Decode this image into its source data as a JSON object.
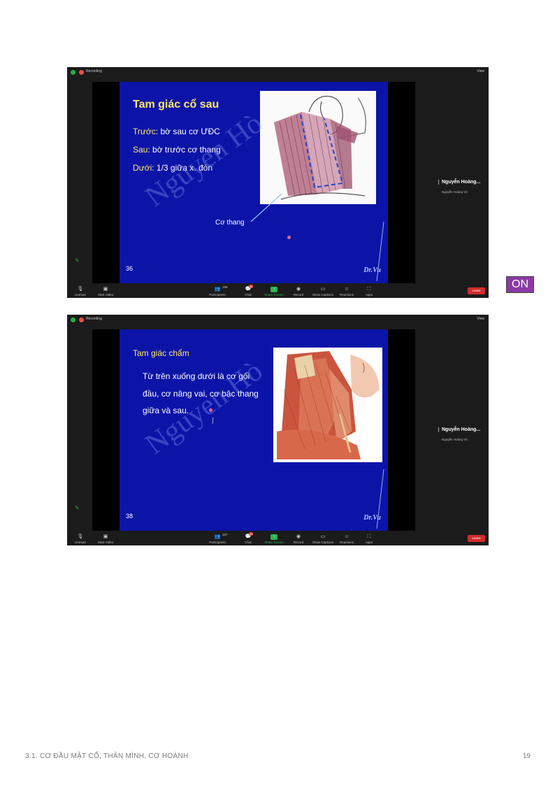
{
  "zoom_common": {
    "recording_label": "Recording",
    "view_label": "View",
    "participant_name": "Nguyễn Hoàng...",
    "participant_sub": "Nguyễn Hoàng Vũ",
    "toolbar": {
      "unmute": "Unmute",
      "start_video": "Start Video",
      "participants": "Participants",
      "chat": "Chat",
      "share_screen": "Share Screen",
      "record": "Record",
      "show_captions": "Show Captions",
      "reactions": "Reactions",
      "apps": "Apps",
      "leave": "Leave"
    }
  },
  "slide1": {
    "title": "Tam giác cổ sau",
    "line1_label": "Trước",
    "line1_text": ": bờ sau cơ ƯĐC",
    "line2_label": "Sau",
    "line2_text": ": bờ trước cơ thang",
    "line3_label": "Dưới",
    "line3_text": ": 1/3 giữa x. đòn",
    "annotation": "Cơ thang",
    "watermark": "Nguyen Hò",
    "slide_number": "36",
    "signature": "Dr.Vu",
    "participants_count": "156",
    "chat_badge": "10"
  },
  "slide2": {
    "title": "Tam giác chẩm",
    "body_line1": "Từ trên xuống dưới là cơ gối",
    "body_line2": "đầu, cơ nâng vai, cơ bậc thang",
    "body_line3": "giữa và sau.",
    "watermark": "Nguyen Hò",
    "slide_number": "38",
    "signature": "Dr.Vu",
    "participants_count": "157",
    "chat_badge": "13"
  },
  "on_badge": "ON",
  "footer": {
    "section": "3.1. CƠ ĐẦU MẶT CỔ, THÂN MÌNH, CƠ HOÀNH",
    "page_number": "19"
  }
}
